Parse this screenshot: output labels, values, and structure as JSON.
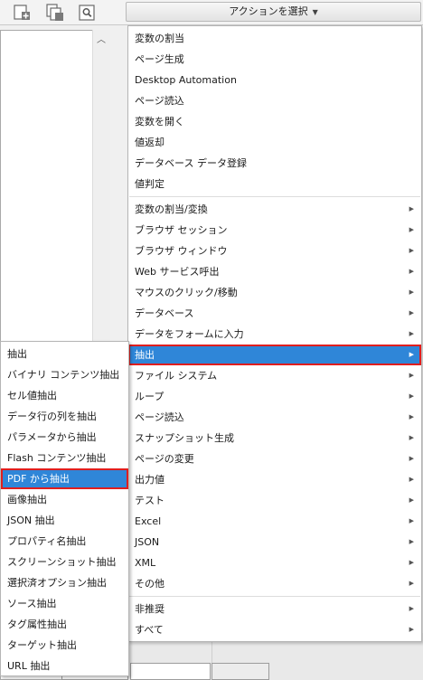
{
  "toolbar": {
    "action_select_label": "アクションを選択",
    "icons": [
      "add-page-icon",
      "copy-page-icon",
      "search-page-icon"
    ]
  },
  "menu": {
    "group1": [
      "変数の割当",
      "ページ生成",
      "Desktop Automation",
      "ページ読込",
      "変数を開く",
      "値返却",
      "データベース データ登録",
      "値判定"
    ],
    "group2": [
      "変数の割当/変換",
      "ブラウザ セッション",
      "ブラウザ ウィンドウ",
      "Web サービス呼出",
      "マウスのクリック/移動",
      "データベース",
      "データをフォームに入力",
      "抽出",
      "ファイル システム",
      "ループ",
      "ページ読込",
      "スナップショット生成",
      "ページの変更",
      "出力値",
      "テスト",
      "Excel",
      "JSON",
      "XML",
      "その他"
    ],
    "group3": [
      "非推奨",
      "すべて"
    ],
    "highlighted": "抽出"
  },
  "submenu": {
    "items": [
      "抽出",
      "バイナリ コンテンツ抽出",
      "セル値抽出",
      "データ行の列を抽出",
      "パラメータから抽出",
      "Flash コンテンツ抽出",
      "PDF から抽出",
      "画像抽出",
      "JSON 抽出",
      "プロパティ名抽出",
      "スクリーンショット抽出",
      "選択済オプション抽出",
      "ソース抽出",
      "タグ属性抽出",
      "ターゲット抽出",
      "URL 抽出"
    ],
    "highlighted": "PDF から抽出"
  },
  "colors": {
    "highlight": "#2f86d8",
    "highlight_border": "#e01e1e"
  }
}
